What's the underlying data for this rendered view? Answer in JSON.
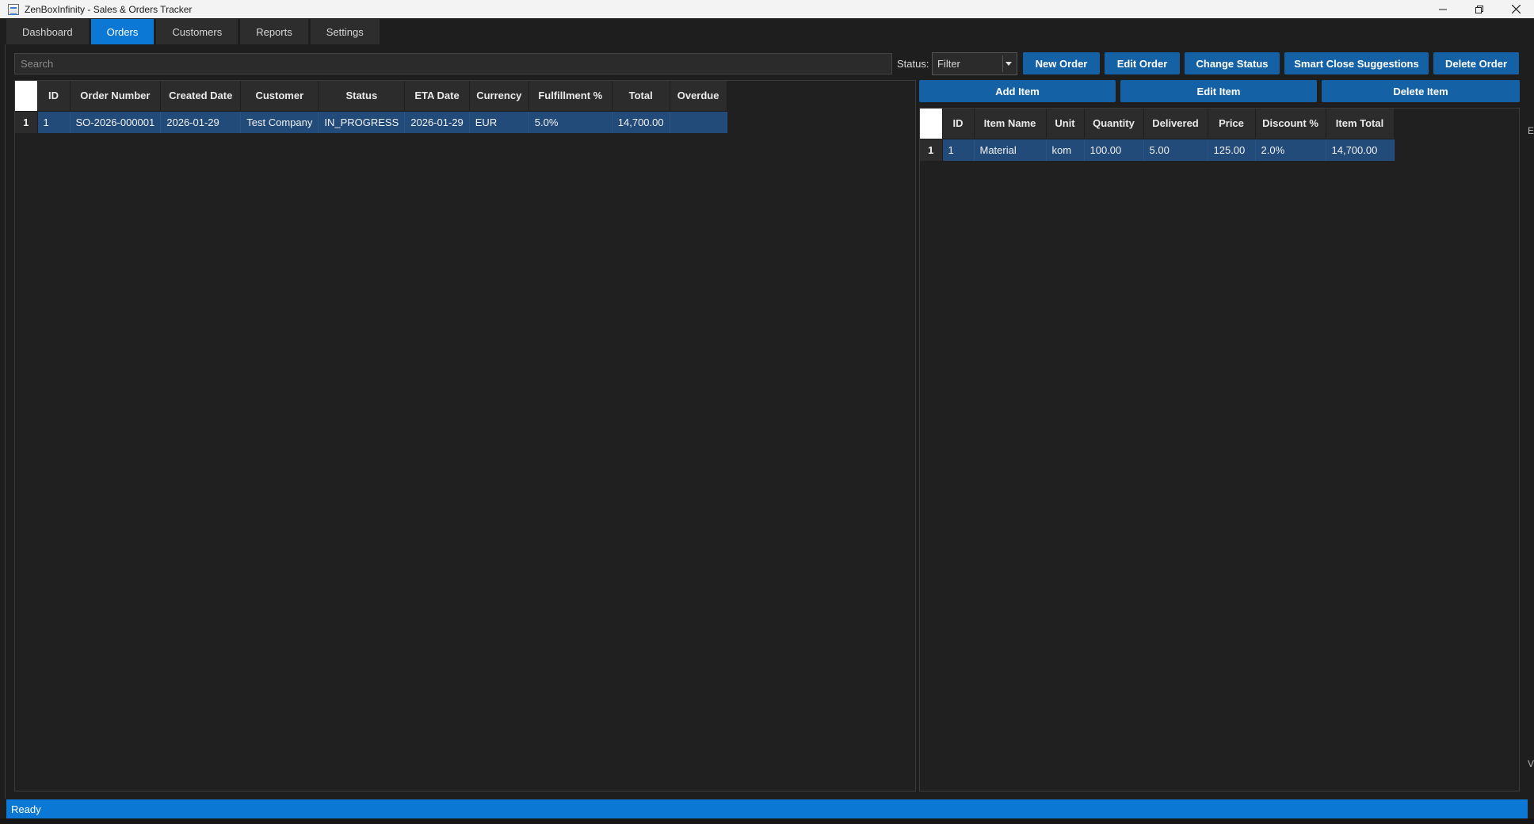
{
  "window": {
    "title": "ZenBoxInfinity - Sales & Orders Tracker"
  },
  "tabs": [
    {
      "label": "Dashboard",
      "active": false
    },
    {
      "label": "Orders",
      "active": true
    },
    {
      "label": "Customers",
      "active": false
    },
    {
      "label": "Reports",
      "active": false
    },
    {
      "label": "Settings",
      "active": false
    }
  ],
  "toolbar": {
    "search_placeholder": "Search",
    "status_label": "Status:",
    "status_value": "Filter",
    "buttons": {
      "new_order": "New Order",
      "edit_order": "Edit Order",
      "change_status": "Change Status",
      "smart_close": "Smart Close Suggestions",
      "delete_order": "Delete Order"
    }
  },
  "orders_table": {
    "columns": [
      "ID",
      "Order Number",
      "Created Date",
      "Customer",
      "Status",
      "ETA Date",
      "Currency",
      "Fulfillment %",
      "Total",
      "Overdue"
    ],
    "rows": [
      {
        "row_number": "1",
        "id": "1",
        "order_number": "SO-2026-000001",
        "created_date": "2026-01-29",
        "customer": "Test Company",
        "status": "IN_PROGRESS",
        "eta_date": "2026-01-29",
        "currency": "EUR",
        "fulfillment": "5.0%",
        "total": "14,700.00",
        "overdue": ""
      }
    ]
  },
  "items_panel": {
    "buttons": {
      "add_item": "Add Item",
      "edit_item": "Edit Item",
      "delete_item": "Delete Item"
    },
    "columns": [
      "ID",
      "Item Name",
      "Unit",
      "Quantity",
      "Delivered",
      "Price",
      "Discount %",
      "Item Total"
    ],
    "rows": [
      {
        "row_number": "1",
        "id": "1",
        "item_name": "Material",
        "unit": "kom",
        "quantity": "100.00",
        "delivered": "5.00",
        "price": "125.00",
        "discount": "2.0%",
        "item_total": "14,700.00"
      }
    ]
  },
  "edge_glyphs": {
    "top": "E",
    "bottom": "V"
  },
  "statusbar": {
    "text": "Ready"
  },
  "colors": {
    "accent": "#0a78d4",
    "button": "#1462a5",
    "selection": "#224b7a",
    "background": "#1e1e1e"
  }
}
